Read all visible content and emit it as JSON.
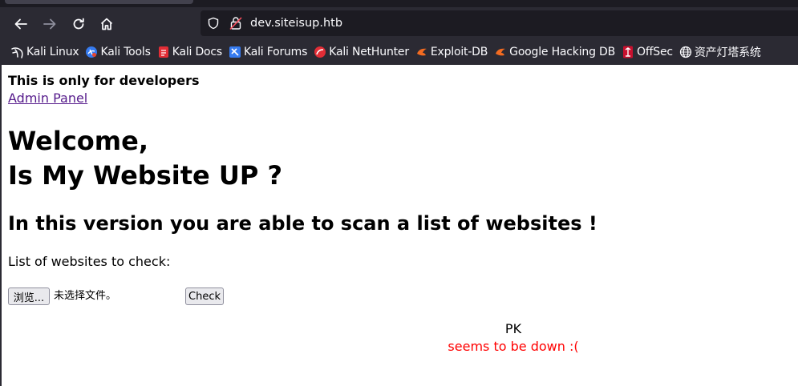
{
  "browser": {
    "url": "dev.siteisup.htb",
    "bookmarks": [
      {
        "label": "Kali Linux",
        "icon": "kali-dragon-icon"
      },
      {
        "label": "Kali Tools",
        "icon": "kali-tools-icon"
      },
      {
        "label": "Kali Docs",
        "icon": "kali-docs-icon"
      },
      {
        "label": "Kali Forums",
        "icon": "kali-forums-icon"
      },
      {
        "label": "Kali NetHunter",
        "icon": "kali-nethunter-icon"
      },
      {
        "label": "Exploit-DB",
        "icon": "exploit-db-icon"
      },
      {
        "label": "Google Hacking DB",
        "icon": "ghdb-icon"
      },
      {
        "label": "OffSec",
        "icon": "offsec-icon"
      },
      {
        "label": "资产灯塔系统",
        "icon": "globe-icon"
      }
    ]
  },
  "page": {
    "dev_note": "This is only for developers",
    "admin_link": "Admin Panel",
    "welcome": "Welcome,",
    "title": "Is My Website UP ?",
    "subtitle": "In this version you are able to scan a list of websites !",
    "list_label": "List of websites to check:",
    "browse_label": "浏览...",
    "no_file_text": "未选择文件。",
    "check_label": "Check",
    "result": {
      "host": "PK",
      "status": "seems to be down :("
    }
  },
  "colors": {
    "chrome_bg": "#2b2a33",
    "link_visited": "#551a8b",
    "status_down": "#ff0000"
  }
}
